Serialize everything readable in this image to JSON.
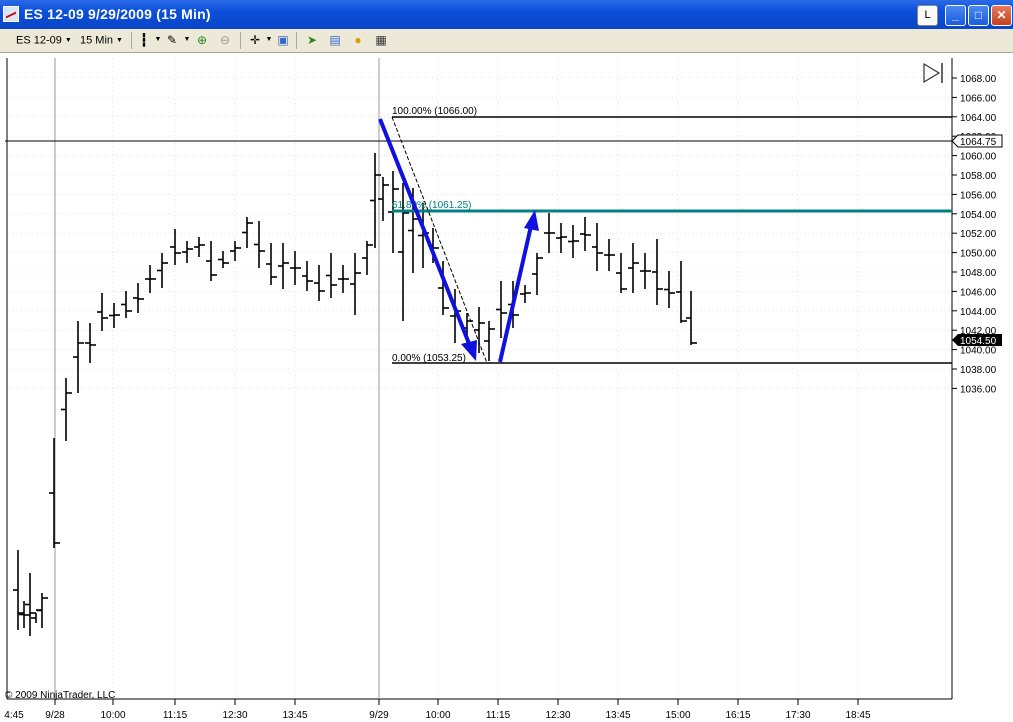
{
  "window": {
    "title": "ES 12-09  9/29/2009 (15 Min)",
    "btn_l": "L",
    "btn_min": "_",
    "btn_max": "□",
    "btn_close": "✕"
  },
  "toolbar": {
    "instrument": "ES 12-09",
    "interval": "15 Min"
  },
  "chart": {
    "copyright": "© 2009 NinjaTrader, LLC",
    "price_labels": [
      "1068.00",
      "1066.00",
      "1064.00",
      "1062.00",
      "1060.00",
      "1058.00",
      "1056.00",
      "1054.00",
      "1052.00",
      "1050.00",
      "1048.00",
      "1046.00",
      "1044.00",
      "1042.00",
      "1040.00",
      "1038.00",
      "1036.00"
    ],
    "crosshair_price": "1064.75",
    "last_price": "1054.50",
    "time_labels": [
      "4:45",
      "9/28",
      "10:00",
      "11:15",
      "12:30",
      "13:45",
      "9/29",
      "10:00",
      "11:15",
      "12:30",
      "13:45",
      "15:00",
      "16:15",
      "17:30",
      "18:45"
    ],
    "fib_100": "100.00% (1066.00)",
    "fib_618": "61.80% (1061.25)",
    "fib_0": "0.00% (1053.25)",
    "colors": {
      "bars": "#000000",
      "fib_mid": "#008080",
      "arrows": "#1010e0"
    }
  }
}
